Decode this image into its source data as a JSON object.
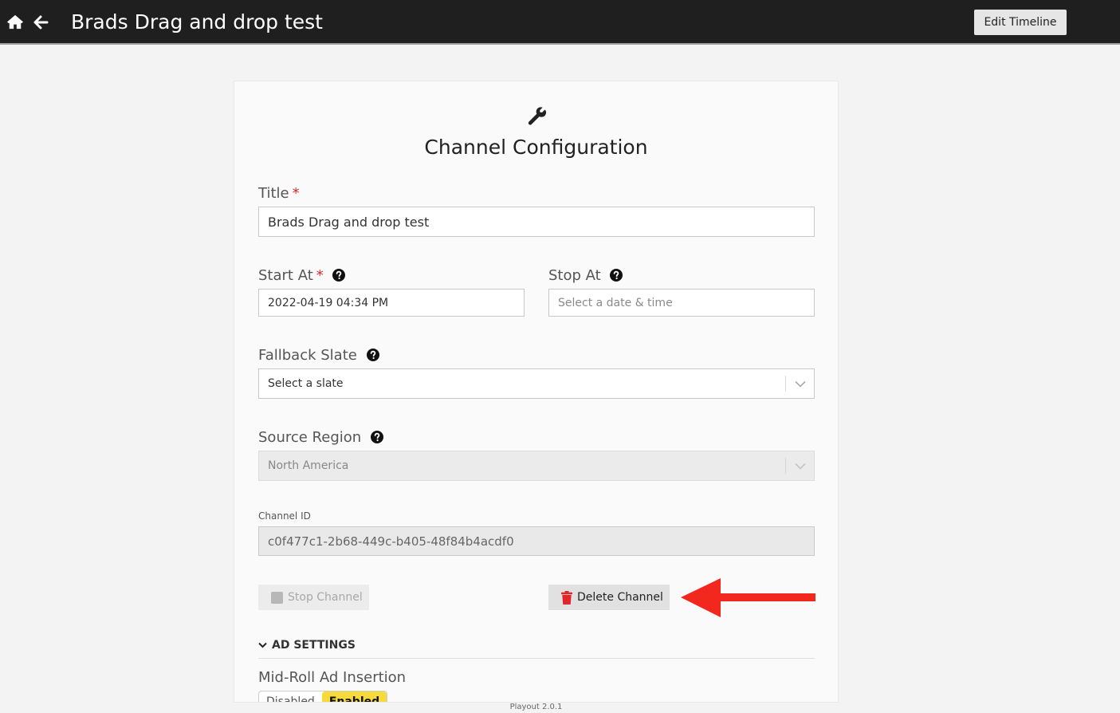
{
  "header": {
    "title": "Brads Drag and drop test",
    "edit_timeline_label": "Edit Timeline",
    "home_icon": "home-icon",
    "back_icon": "arrow-left-icon"
  },
  "card": {
    "icon": "wrench-icon",
    "title": "Channel Configuration",
    "title_field": {
      "label": "Title",
      "required_mark": "*",
      "value": "Brads Drag and drop test"
    },
    "start_at": {
      "label": "Start At",
      "required_mark": "*",
      "value": "2022-04-19 04:34 PM"
    },
    "stop_at": {
      "label": "Stop At",
      "placeholder": "Select a date & time"
    },
    "fallback_slate": {
      "label": "Fallback Slate",
      "value": "Select a slate"
    },
    "source_region": {
      "label": "Source Region",
      "value": "North America"
    },
    "channel_id": {
      "label": "Channel ID",
      "value": "c0f477c1-2b68-449c-b405-48f84b4acdf0"
    },
    "stop_channel_label": "Stop Channel",
    "delete_channel_label": "Delete Channel",
    "ad_settings": {
      "header": "AD SETTINGS",
      "mid_roll_label": "Mid-Roll Ad Insertion",
      "toggle_off": "Disabled",
      "toggle_on": "Enabled",
      "selected": "Enabled"
    }
  },
  "footer": {
    "version": "Playout 2.0.1"
  },
  "colors": {
    "topbar": "#1f1f1f",
    "required": "#d62a2a",
    "delete_icon": "#e0262b",
    "annotation_arrow": "#f2281e",
    "toggle_selected": "#f6d93a"
  }
}
